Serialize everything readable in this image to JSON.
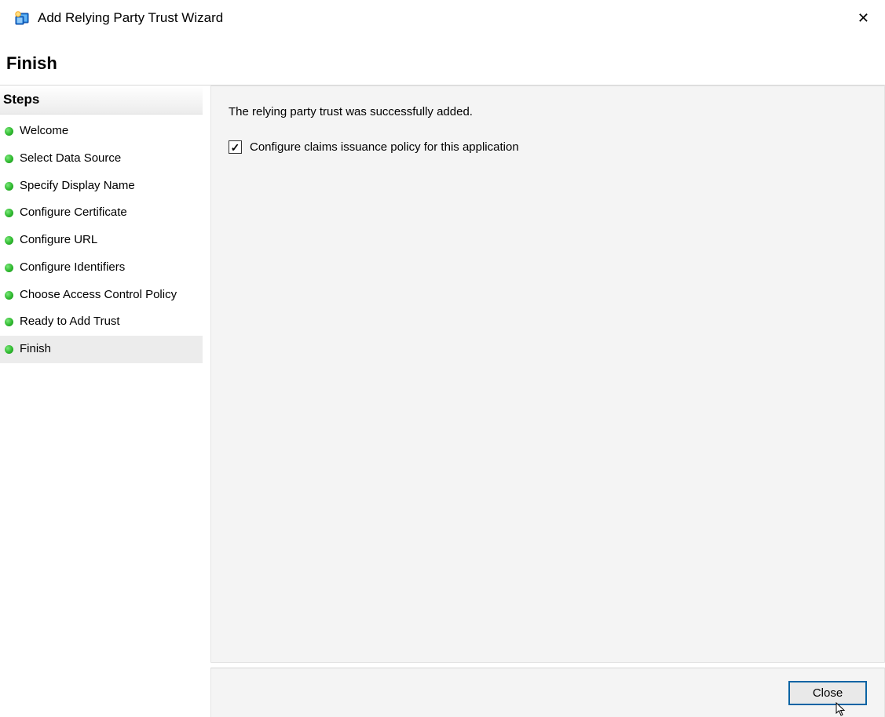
{
  "window": {
    "title": "Add Relying Party Trust Wizard"
  },
  "page": {
    "heading": "Finish"
  },
  "sidebar": {
    "header": "Steps",
    "steps": [
      {
        "label": "Welcome"
      },
      {
        "label": "Select Data Source"
      },
      {
        "label": "Specify Display Name"
      },
      {
        "label": "Configure Certificate"
      },
      {
        "label": "Configure URL"
      },
      {
        "label": "Configure Identifiers"
      },
      {
        "label": "Choose Access Control Policy"
      },
      {
        "label": "Ready to Add Trust"
      },
      {
        "label": "Finish",
        "active": true
      }
    ]
  },
  "main": {
    "success_message": "The relying party trust was successfully added.",
    "checkbox_label": "Configure claims issuance policy for this application",
    "checkbox_checked": true
  },
  "buttons": {
    "close": "Close"
  }
}
